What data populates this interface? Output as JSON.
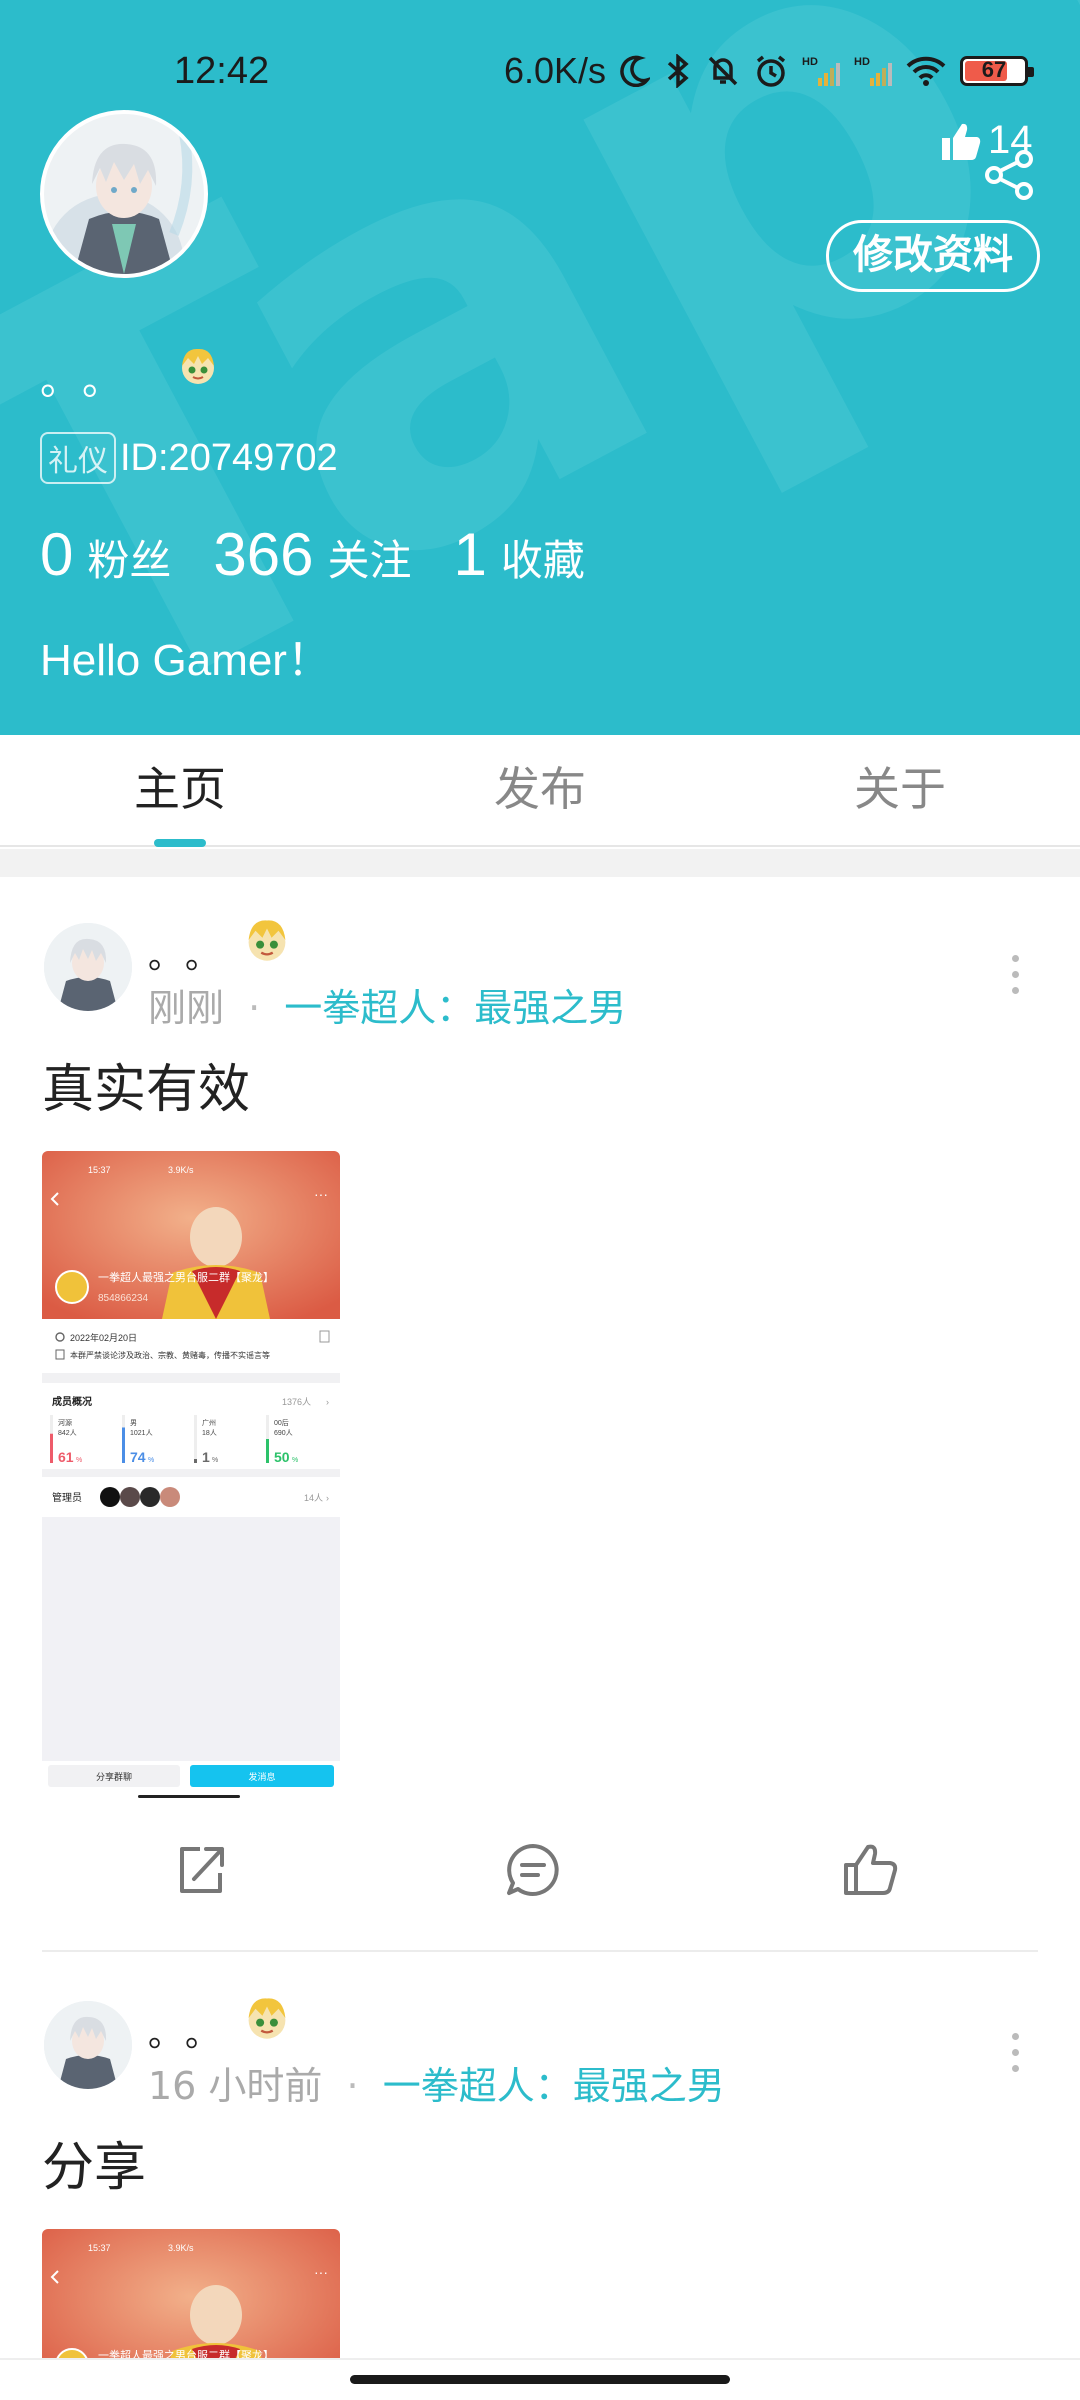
{
  "status_bar": {
    "time": "12:42",
    "net_speed": "6.0K/s",
    "battery": "67",
    "icons": [
      "moon-icon",
      "bluetooth-icon",
      "mute-icon",
      "alarm-icon",
      "signal-hd-icon",
      "signal-hd-icon",
      "wifi-icon",
      "battery-icon"
    ]
  },
  "profile": {
    "likes": "14",
    "edit_label": "修改资料",
    "username": "。。",
    "etiquette_badge": "礼仪",
    "id_text": "ID:20749702",
    "stats": [
      {
        "value": "0",
        "label": "粉丝"
      },
      {
        "value": "366",
        "label": "关注"
      },
      {
        "value": "1",
        "label": "收藏"
      }
    ],
    "bio": "Hello Gamer！",
    "watermark_text": "TapTap"
  },
  "tabs": [
    {
      "label": "主页",
      "active": true
    },
    {
      "label": "发布",
      "active": false
    },
    {
      "label": "关于",
      "active": false
    }
  ],
  "posts": [
    {
      "author": "。。",
      "time": "刚刚",
      "separator": "·",
      "circle": "一拳超人：最强之男",
      "title": "真实有效",
      "image": {
        "status_time": "15:37",
        "status_speed": "3.9K/s",
        "group_name": "一拳超人最强之男台服二群【聚龙】",
        "group_id": "854866234",
        "date": "2022年02月20日",
        "rule": "本群严禁谈论涉及政治、宗教、黄赌毒，传播不实谣言等",
        "section_title": "成员概况",
        "member_total": "1376人",
        "stats": [
          {
            "name": "河源",
            "count": "842人",
            "pct": "61",
            "color": "#ee5b6a"
          },
          {
            "name": "男",
            "count": "1021人",
            "pct": "74",
            "color": "#4b8ee6"
          },
          {
            "name": "广州",
            "count": "18人",
            "pct": "1",
            "color": "#6a6a6a"
          },
          {
            "name": "00后",
            "count": "690人",
            "pct": "50",
            "color": "#2cc26a"
          }
        ],
        "admin_label": "管理员",
        "admin_count": "14人",
        "share_btn": "分享群聊",
        "send_btn": "发消息"
      }
    },
    {
      "author": "。。",
      "time": "16 小时前",
      "separator": "·",
      "circle": "一拳超人：最强之男",
      "title": "分享",
      "image": {
        "status_time": "15:37",
        "status_speed": "3.9K/s",
        "group_name": "一拳超人最强之男台服二群【聚龙】"
      }
    }
  ]
}
